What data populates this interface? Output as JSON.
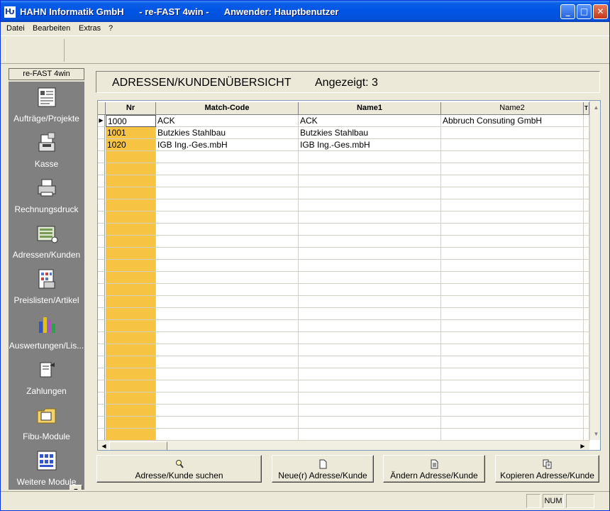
{
  "window": {
    "logo": "Ƕ",
    "title": "HAHN Informatik GmbH      - re-FAST 4win -      Anwender: Hauptbenutzer",
    "minimize": "_",
    "maximize": "□",
    "close": "✕"
  },
  "menu": [
    "Datei",
    "Bearbeiten",
    "Extras",
    "?"
  ],
  "sidebar": {
    "header": "re-FAST 4win",
    "items": [
      {
        "label": "Aufträge/Projekte",
        "icon": "document-list-icon"
      },
      {
        "label": "Kasse",
        "icon": "cash-register-icon"
      },
      {
        "label": "Rechnungsdruck",
        "icon": "printer-icon"
      },
      {
        "label": "Adressen/Kunden",
        "icon": "address-book-icon"
      },
      {
        "label": "Preislisten/Artikel",
        "icon": "price-list-icon"
      },
      {
        "label": "Auswertungen/Lis...",
        "icon": "bar-chart-icon"
      },
      {
        "label": "Zahlungen",
        "icon": "payment-icon"
      },
      {
        "label": "Fibu-Module",
        "icon": "folder-icon"
      },
      {
        "label": "Weitere Module",
        "icon": "modules-icon"
      }
    ],
    "scroll_down": "▼"
  },
  "main": {
    "title": "ADRESSEN/KUNDENÜBERSICHT",
    "shown": "Angezeigt: 3",
    "grid": {
      "columns": [
        "Nr",
        "Match-Code",
        "Name1",
        "Name2",
        "T"
      ],
      "rows": [
        {
          "nr": "1000",
          "match": "ACK",
          "name1": "ACK",
          "name2": "Abbruch Consuting GmbH"
        },
        {
          "nr": "1001",
          "match": "Butzkies Stahlbau",
          "name1": "Butzkies Stahlbau",
          "name2": ""
        },
        {
          "nr": "1020",
          "match": "IGB Ing.-Ges.mbH",
          "name1": "IGB Ing.-Ges.mbH",
          "name2": ""
        }
      ],
      "current_row_marker": "▶"
    },
    "buttons": {
      "search": "Adresse/Kunde suchen",
      "new": "Neue(r) Adresse/Kunde",
      "edit": "Ändern Adresse/Kunde",
      "copy": "Kopieren Adresse/Kunde"
    }
  },
  "statusbar": {
    "num": "NUM"
  },
  "colors": {
    "title_bar": "#0054e3",
    "sidebar_bg": "#808080",
    "nr_column": "#f7c342"
  }
}
